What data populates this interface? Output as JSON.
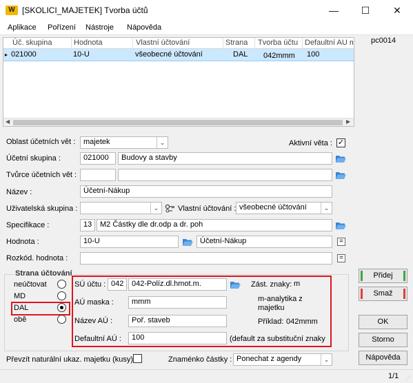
{
  "window": {
    "title": "[SKOLICI_MAJETEK] Tvorba účtů",
    "app_icon": "W",
    "controls": {
      "minimize": "—",
      "maximize": "☐",
      "close": "✕"
    }
  },
  "menu": [
    "Aplikace",
    "Pořízení",
    "Nástroje",
    "Nápověda"
  ],
  "grid": {
    "columns": [
      "Úč. skupina",
      "Hodnota",
      "Vlastní účtování",
      "Strana",
      "Tvorba účtu",
      "Defaultní AU m"
    ],
    "rows": [
      {
        "marker": "▸",
        "skupina": "021000",
        "hodnota": "10-U",
        "vlastni": "všeobecné účtování",
        "strana": "DAL",
        "tvorba": "042mmm",
        "default": "100"
      }
    ]
  },
  "pc_label": "pc0014",
  "form": {
    "oblast_label": "Oblast účetních vět :",
    "oblast_value": "majetek",
    "aktivni_label": "Aktivní věta :",
    "aktivni_checked": "✓",
    "skupina_label": "Účetní skupina :",
    "skupina_code": "021000",
    "skupina_name": "Budovy a stavby",
    "tvorce_label": "Tvůrce účetních vět :",
    "nazev_label": "Název :",
    "nazev_value": "Účetní-Nákup",
    "uzivatelska_label": "Uživatelská skupina :",
    "vlastni_label": "Vlastní účtování :",
    "vlastni_value": "všeobecné účtování",
    "specifikace_label": "Specifikace :",
    "specifikace_code": "13",
    "specifikace_name": "M2 Částky dle dr.odp a dr. poh",
    "hodnota_label": "Hodnota :",
    "hodnota_value": "10-U",
    "hodnota_name": "Účetní-Nákup",
    "rozkod_label": "Rozkód. hodnota :"
  },
  "strana": {
    "title": "Strana účtování",
    "options": [
      "neúčtovat",
      "MD",
      "DAL",
      "obě"
    ],
    "selected": "DAL"
  },
  "su": {
    "su_label": "SÚ účtu :",
    "su_code": "042",
    "su_name": "042-Políz.dl.hmot.m.",
    "au_maska_label": "AÚ maska :",
    "au_maska_value": "mmm",
    "nazev_au_label": "Název AÚ :",
    "nazev_au_value": "Poř. staveb",
    "default_au_label": "Defaultní AÚ :",
    "default_au_value": "100",
    "default_note": "(default za substituční znaky",
    "zast_label": "Zást. znaky:",
    "zast_value": "m",
    "analytika": "m-analytika z majetku",
    "priklad_label": "Příklad:",
    "priklad_value": "042mmm"
  },
  "bottom": {
    "prevzit_label": "Převzít naturální ukaz. majetku (kusy)",
    "znamenko_label": "Znaménko částky :",
    "znamenko_value": "Ponechat z agendy"
  },
  "buttons": {
    "pridej": "Přidej",
    "smaz": "Smaž",
    "ok": "OK",
    "storno": "Storno",
    "napoveda": "Nápověda"
  },
  "status": {
    "page": "1/1"
  },
  "colors": {
    "selection": "#cce8ff",
    "highlight": "#e0141c",
    "pridej_accent": "#3aa845",
    "smaz_accent": "#d9413a"
  }
}
